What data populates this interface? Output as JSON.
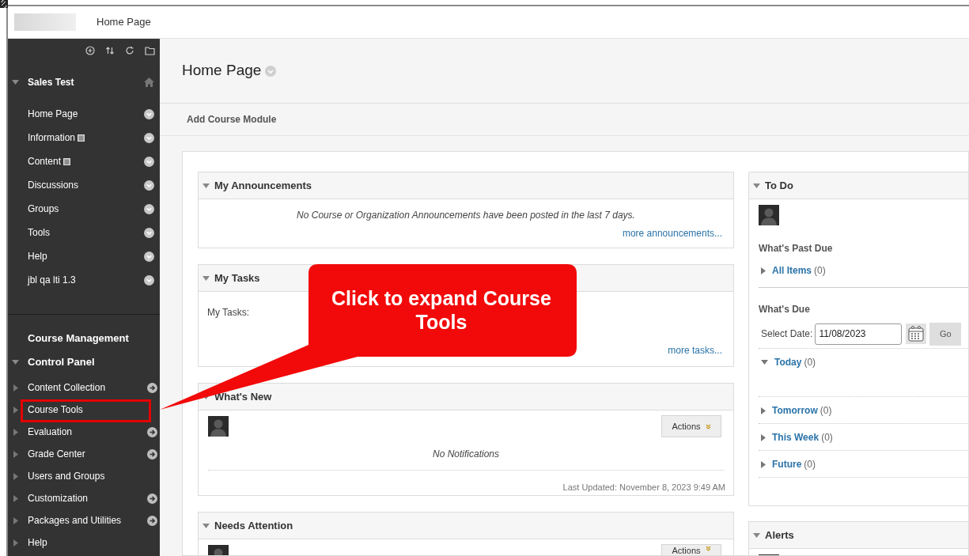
{
  "top_bar": {
    "breadcrumb": "Home Page"
  },
  "sidebar": {
    "course_title": "Sales Test",
    "course_menu": [
      {
        "label": "Home Page",
        "has_page_icon": false
      },
      {
        "label": "Information",
        "has_page_icon": true
      },
      {
        "label": "Content",
        "has_page_icon": true
      },
      {
        "label": "Discussions",
        "has_page_icon": false
      },
      {
        "label": "Groups",
        "has_page_icon": false
      },
      {
        "label": "Tools",
        "has_page_icon": false
      },
      {
        "label": "Help",
        "has_page_icon": false
      },
      {
        "label": "jbl qa lti 1.3",
        "has_page_icon": false
      }
    ],
    "management_title": "Course Management",
    "control_panel": {
      "label": "Control Panel",
      "expanded": true
    },
    "panel_items": [
      {
        "label": "Content Collection",
        "has_link_icon": true
      },
      {
        "label": "Course Tools",
        "has_link_icon": false
      },
      {
        "label": "Evaluation",
        "has_link_icon": true
      },
      {
        "label": "Grade Center",
        "has_link_icon": true
      },
      {
        "label": "Users and Groups",
        "has_link_icon": false
      },
      {
        "label": "Customization",
        "has_link_icon": true
      },
      {
        "label": "Packages and Utilities",
        "has_link_icon": true
      },
      {
        "label": "Help",
        "has_link_icon": false
      }
    ]
  },
  "page": {
    "title": "Home Page",
    "add_module": "Add Course Module"
  },
  "modules_left": [
    {
      "kind": "announcements",
      "title": "My Announcements",
      "message": "No Course or Organization Announcements have been posted in the last 7 days.",
      "link": "more announcements..."
    },
    {
      "kind": "tasks",
      "title": "My Tasks",
      "label": "My Tasks:",
      "link": "more tasks..."
    },
    {
      "kind": "whats_new",
      "title": "What's New",
      "actions": "Actions",
      "message": "No Notifications",
      "updated": "Last Updated: November 8, 2023 9:49 AM"
    },
    {
      "kind": "needs_attention",
      "title": "Needs Attention",
      "actions": "Actions"
    }
  ],
  "modules_right": [
    {
      "kind": "todo",
      "title": "To Do",
      "past_due_title": "What's Past Due",
      "past_due": [
        {
          "label": "All Items",
          "count": "(0)",
          "expanded": false
        }
      ],
      "due_title": "What's Due",
      "date_label": "Select Date:",
      "date_value": "11/08/2023",
      "go": "Go",
      "due_groups": [
        {
          "label": "Today",
          "count": "(0)",
          "expanded": true
        },
        {
          "label": "Tomorrow",
          "count": "(0)",
          "expanded": false
        },
        {
          "label": "This Week",
          "count": "(0)",
          "expanded": false
        },
        {
          "label": "Future",
          "count": "(0)",
          "expanded": false
        }
      ]
    },
    {
      "kind": "alerts",
      "title": "Alerts"
    }
  ],
  "callout": {
    "text": "Click to expand Course Tools"
  }
}
